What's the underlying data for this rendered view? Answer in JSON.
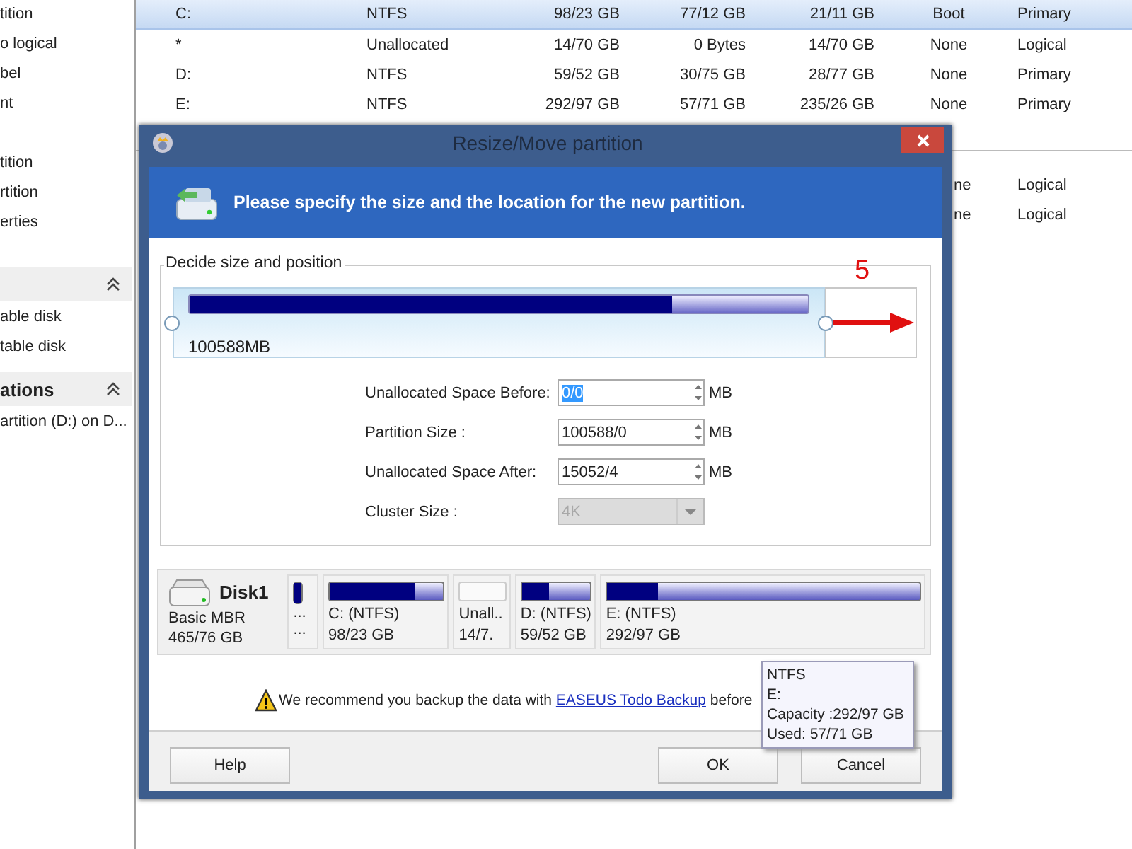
{
  "sidebar": {
    "blocks": [
      {
        "kind": "list",
        "items": [
          "tition",
          "o logical",
          "bel",
          "nt"
        ]
      },
      {
        "kind": "list",
        "items": [
          "tition",
          "rtition",
          "erties"
        ]
      },
      {
        "kind": "section",
        "expanded": true,
        "items": [
          "able disk",
          "table disk"
        ]
      },
      {
        "kind": "section",
        "title": "ations",
        "expanded": true,
        "items": [
          "artition (D:) on D..."
        ]
      }
    ]
  },
  "table": {
    "rows": [
      {
        "drive": "C:",
        "file_system": "NTFS",
        "capacity": "98/23 GB",
        "used": "77/12 GB",
        "unused": "21/11 GB",
        "status": "Boot",
        "type": "Primary",
        "selected": true
      },
      {
        "drive": "*",
        "file_system": "Unallocated",
        "capacity": "14/70 GB",
        "used": "0 Bytes",
        "unused": "14/70 GB",
        "status": "None",
        "type": "Logical",
        "selected": false
      },
      {
        "drive": "D:",
        "file_system": "NTFS",
        "capacity": "59/52 GB",
        "used": "30/75 GB",
        "unused": "28/77 GB",
        "status": "None",
        "type": "Primary",
        "selected": false
      },
      {
        "drive": "E:",
        "file_system": "NTFS",
        "capacity": "292/97 GB",
        "used": "57/71 GB",
        "unused": "235/26 GB",
        "status": "None",
        "type": "Primary",
        "selected": false
      }
    ]
  },
  "table_2": {
    "rows": [
      {
        "status": "ne",
        "type": "Logical"
      },
      {
        "status": "ne",
        "type": "Logical"
      }
    ]
  },
  "dialog": {
    "title": "Resize/Move partition",
    "heading": "Please specify the size and the location for the new partition.",
    "group_title": "Decide size and position",
    "size_bar": {
      "level": 0.78,
      "label": "100588MB"
    },
    "annotation": "5",
    "fields": [
      {
        "kind": "spin",
        "label": "Unallocated Space Before:",
        "value": "0/0",
        "unit": "MB",
        "selected": true,
        "disabled": false
      },
      {
        "kind": "spin",
        "label": "Partition Size :",
        "value": "100588/0",
        "unit": "MB",
        "selected": false,
        "disabled": false
      },
      {
        "kind": "spin",
        "label": "Unallocated Space After:",
        "value": "15052/4",
        "unit": "MB",
        "selected": false,
        "disabled": false
      },
      {
        "kind": "combo",
        "label": "Cluster Size :",
        "value": "4K",
        "selected": false,
        "disabled": true
      }
    ],
    "disk": {
      "name": "Disk1",
      "type": "Basic MBR",
      "size": "465/76 GB"
    },
    "partitions": [
      {
        "kind": "tiny",
        "label": "...",
        "size": "...",
        "level": 1
      },
      {
        "kind": "partition",
        "label": "C: (NTFS)",
        "size": "98/23 GB",
        "level": 0.75
      },
      {
        "kind": "unallocated",
        "label": "Unall..",
        "size": "14/7."
      },
      {
        "kind": "partition",
        "label": "D: (NTFS)",
        "size": "59/52 GB",
        "level": 0.4
      },
      {
        "kind": "partition",
        "label": "E: (NTFS)",
        "size": "292/97 GB",
        "level": 0.16
      }
    ],
    "warning": {
      "before": "We recommend you backup the data with",
      "link": "EASEUS Todo Backup",
      "after": "before"
    },
    "tooltip": [
      "NTFS",
      "E:",
      "Capacity :292/97 GB",
      "Used: 57/71 GB"
    ],
    "buttons": [
      {
        "label": "Help",
        "kind": "left"
      },
      {
        "label": "OK",
        "kind": "right"
      },
      {
        "label": "Cancel",
        "kind": "right"
      }
    ]
  }
}
